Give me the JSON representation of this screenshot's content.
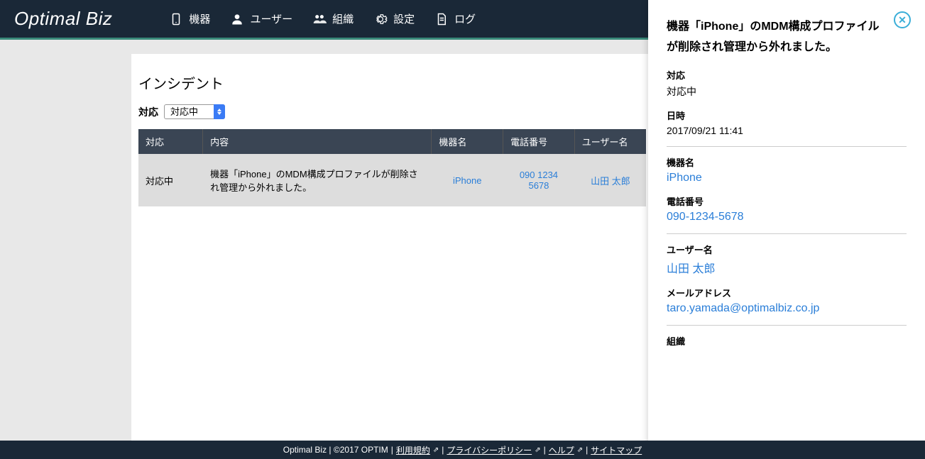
{
  "brand": "Optimal Biz",
  "nav": {
    "devices": "機器",
    "users": "ユーザー",
    "orgs": "組織",
    "settings": "設定",
    "logs": "ログ"
  },
  "page": {
    "title": "インシデント",
    "filter_label": "対応",
    "filter_value": "対応中"
  },
  "table": {
    "headers": {
      "status": "対応",
      "content": "内容",
      "device": "機器名",
      "phone": "電話番号",
      "user": "ユーザー名"
    },
    "row": {
      "status": "対応中",
      "content": "機器「iPhone」のMDM構成プロファイルが削除され管理から外れました。",
      "device": "iPhone",
      "phone": "090 1234 5678",
      "user": "山田 太郎"
    }
  },
  "detail": {
    "title": "機器「iPhone」のMDM構成プロファイルが削除され管理から外れました。",
    "status_label": "対応",
    "status_value": "対応中",
    "datetime_label": "日時",
    "datetime_value": "2017/09/21 11:41",
    "device_label": "機器名",
    "device_value": "iPhone",
    "phone_label": "電話番号",
    "phone_value": "090-1234-5678",
    "user_label": "ユーザー名",
    "user_value": "山田 太郎",
    "email_label": "メールアドレス",
    "email_value": "taro.yamada@optimalbiz.co.jp",
    "org_label": "組織"
  },
  "footer": {
    "prefix": "Optimal Biz | ©2017 OPTIM",
    "terms": "利用規約",
    "privacy": "プライバシーポリシー",
    "help": "ヘルプ",
    "sitemap": "サイトマップ"
  }
}
